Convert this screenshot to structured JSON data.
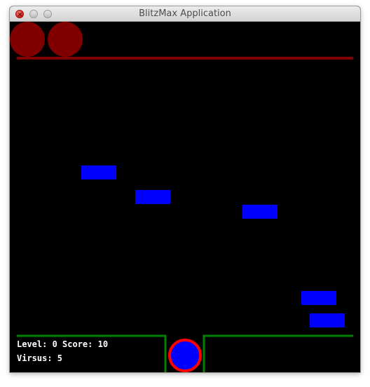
{
  "window": {
    "title": "BlitzMax Application",
    "buttons": [
      "close",
      "minimize",
      "zoom"
    ]
  },
  "hud": {
    "level_label": "Level:",
    "level_value": "0",
    "score_label": "Score:",
    "score_value": "10",
    "level_line": "Level: 0 Score: 10",
    "virus_label": "Virsus:",
    "virus_value": "5",
    "virus_line": "Virsus: 5"
  },
  "game": {
    "lives": 2,
    "falling_block_count": 5,
    "colors": {
      "background": "#000000",
      "life_ball": "#800000",
      "top_bar": "#800000",
      "block": "#0000ff",
      "floor_line": "#008000",
      "player_fill": "#0000ff",
      "player_ring": "#ff0000",
      "text": "#ffffff"
    }
  }
}
